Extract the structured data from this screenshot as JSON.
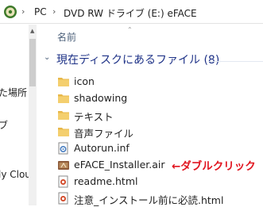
{
  "address": {
    "crumbs": [
      "PC",
      "DVD RW ドライブ (E:) eFACE"
    ]
  },
  "nav": {
    "items": [
      "た場所",
      "ブ",
      "ly Clou"
    ]
  },
  "column_header": {
    "name_label": "名前"
  },
  "group": {
    "title": "現在ディスクにあるファイル (8)"
  },
  "files": [
    {
      "name": "icon",
      "type": "folder-icon"
    },
    {
      "name": "shadowing",
      "type": "folder-icon"
    },
    {
      "name": "テキスト",
      "type": "folder-icon"
    },
    {
      "name": "音声ファイル",
      "type": "folder-icon"
    },
    {
      "name": "Autorun.inf",
      "type": "settings-file-icon"
    },
    {
      "name": "eFACE_Installer.air",
      "type": "air-installer-icon"
    },
    {
      "name": "readme.html",
      "type": "html-file-icon"
    },
    {
      "name": "注意_インストール前に必読.html",
      "type": "html-file-icon"
    }
  ],
  "annotation": {
    "text": "←ダブルクリック",
    "color": "#e11520"
  },
  "colors": {
    "folder": "#e8b84a",
    "group_title": "#1e3287",
    "header_text": "#4c607a"
  }
}
